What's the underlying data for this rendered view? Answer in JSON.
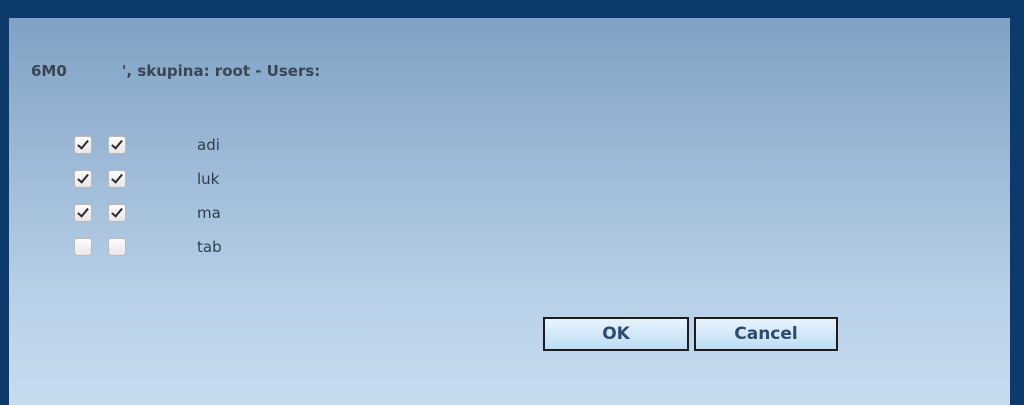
{
  "dialog": {
    "title_prefix": "6M0",
    "title_suffix": "', skupina: root - Users:",
    "ok_label": "OK",
    "cancel_label": "Cancel"
  },
  "users": [
    {
      "name": "adi",
      "check1": true,
      "check2": true
    },
    {
      "name": "luk",
      "check1": true,
      "check2": true
    },
    {
      "name": "ma",
      "check1": true,
      "check2": true
    },
    {
      "name": "tab",
      "check1": false,
      "check2": false
    }
  ],
  "colors": {
    "frame": "#0b3a6b",
    "button_text": "#2e4a6c"
  }
}
